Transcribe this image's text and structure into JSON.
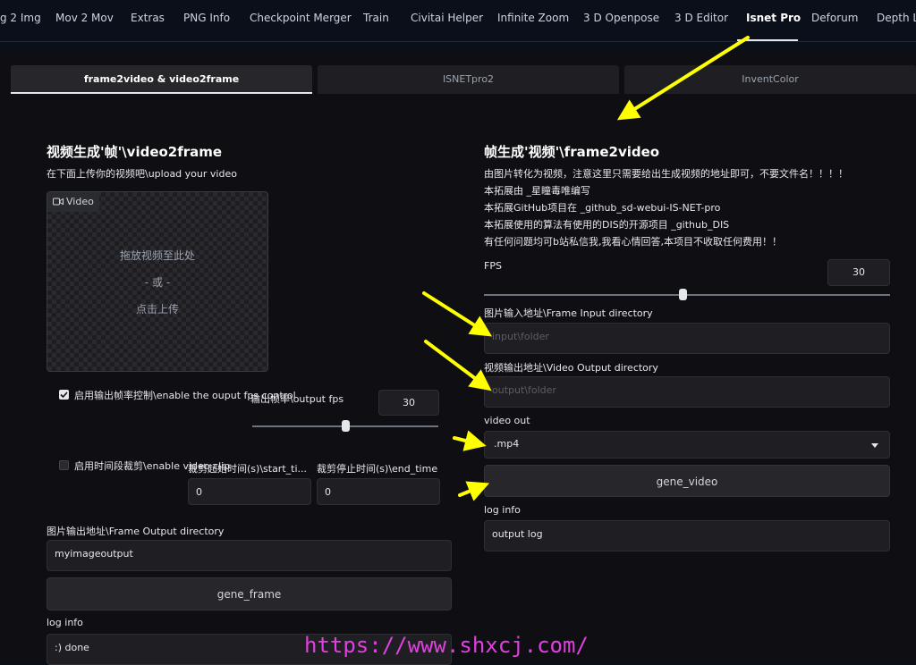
{
  "nav": {
    "tabs": [
      "g 2 Img",
      "Mov 2 Mov",
      "Extras",
      "PNG Info",
      "Checkpoint Merger",
      "Train",
      "Civitai Helper",
      "Infinite Zoom",
      "3 D Openpose",
      "3 D Editor",
      "Isnet Pro",
      "Deforum",
      "Depth Li"
    ],
    "active": "Isnet Pro"
  },
  "subtabs": [
    "frame2video & video2frame",
    "ISNETpro2",
    "InventColor"
  ],
  "left": {
    "title": "视频生成'帧'\\video2frame",
    "subtitle": "在下面上传你的视频吧\\upload your video",
    "video_label": "Video",
    "drop1": "拖放视频至此处",
    "drop2": "- 或 -",
    "drop3": "点击上传",
    "fps_check_label": "启用输出帧率控制\\enable the ouput fps control",
    "fps_label": "输出帧率\\output fps",
    "fps_value": "30",
    "fps_slider": 0.5,
    "time_check_label": "启用时间段裁剪\\enable video clip",
    "start_label": "裁剪起始时间(s)\\start_ti...",
    "start_value": "0",
    "end_label": "裁剪停止时间(s)\\end_time",
    "end_value": "0",
    "out_dir_label": "图片输出地址\\Frame Output directory",
    "out_dir_value": "myimageoutput",
    "gene_frame": "gene_frame",
    "log_label": "log info",
    "log_value": ":) done"
  },
  "right": {
    "title": "帧生成'视频'\\frame2video",
    "line1": "由图片转化为视频，注意这里只需要给出生成视频的地址即可，不要文件名！！！！",
    "line2": "本拓展由 _星瞳毒唯编写",
    "line3": "本拓展GitHub项目在 _github_sd-webui-IS-NET-pro",
    "line4": "本拓展使用的算法有使用的DIS的开源项目 _github_DIS",
    "line5": "有任何问题均可b站私信我,我看心情回答,本项目不收取任何费用！！",
    "fps_label": "FPS",
    "fps_value": "30",
    "fps_slider": 0.49,
    "input_dir_label": "图片输入地址\\Frame Input directory",
    "input_dir_placeholder": "input\\folder",
    "output_dir_label": "视频输出地址\\Video Output directory",
    "output_dir_placeholder": "output\\folder",
    "video_out_label": "video out",
    "video_out_value": ".mp4",
    "gene_video": "gene_video",
    "log_label": "log info",
    "log_value": "output log"
  },
  "watermark": "https://www.shxcj.com/",
  "colors": {
    "annotation_arrow": "#ffff00",
    "watermark": "#e040e0"
  }
}
